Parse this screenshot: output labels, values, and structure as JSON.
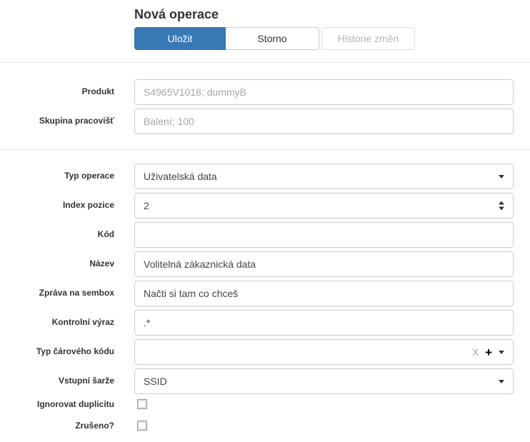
{
  "page": {
    "title": "Nová operace"
  },
  "toolbar": {
    "save": "Uložit",
    "cancel": "Storno",
    "history": "Historie změn"
  },
  "colors": {
    "primary_button": "#3879b5",
    "divider": "#e7e7e7",
    "input_border": "#cccccc",
    "muted_text": "#a6a6a6"
  },
  "form": {
    "produkt": {
      "label": "Produkt",
      "value": "S4965V1018; dummyB"
    },
    "skupina_pracovist": {
      "label": "Skupina pracovišť",
      "value": "Balení; 100"
    },
    "typ_operace": {
      "label": "Typ operace",
      "value": "Uživatelská data"
    },
    "index_pozice": {
      "label": "Index pozice",
      "value": "2"
    },
    "kod": {
      "label": "Kód",
      "value": ""
    },
    "nazev": {
      "label": "Název",
      "value": "Volitelná zákaznická data"
    },
    "zprava_na_sembox": {
      "label": "Zpráva na sembox",
      "value": "Načti si tam co chceš"
    },
    "kontrolni_vyraz": {
      "label": "Kontrolní výraz",
      "value": ".*"
    },
    "typ_caroveho_kodu": {
      "label": "Typ čárového kódu",
      "value": "",
      "clear_glyph": "X",
      "add_glyph": "+"
    },
    "vstupni_sarze": {
      "label": "Vstupní šarže",
      "value": "SSID"
    },
    "ignorovat_duplicitu": {
      "label": "Ignorovat duplicitu",
      "checked": false
    },
    "zruseno": {
      "label": "Zrušeno?",
      "checked": false
    }
  }
}
